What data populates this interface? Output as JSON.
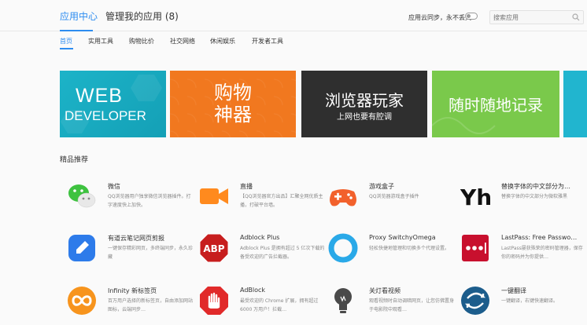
{
  "header": {
    "tab_app_center": "应用中心",
    "tab_manage": "管理我的应用 (8)",
    "sync_label": "应用云同步，永不丢失",
    "search_placeholder": "搜索应用"
  },
  "subnav": {
    "items": [
      "首页",
      "实用工具",
      "购物比价",
      "社交网络",
      "休闲娱乐",
      "开发者工具"
    ]
  },
  "banners": [
    {
      "line1": "WEB",
      "line2": "DEVELOPER",
      "color": "#17a9bf"
    },
    {
      "line1": "购物",
      "line2": "神器",
      "color": "#f1781f"
    },
    {
      "line1": "浏览器玩家",
      "line2": "上网也要有腔调",
      "color": "#2f2f2f"
    },
    {
      "line1": "随时随地记录",
      "color": "#7ac94b"
    },
    {
      "line1": "",
      "color": "#21b5cf"
    }
  ],
  "section": {
    "title": "精品推荐"
  },
  "apps": [
    {
      "name": "微信",
      "desc": "QQ浏览器用户独享微信浏览器插件。打字速度快上加快。",
      "icon": "wechat-icon"
    },
    {
      "name": "直播",
      "desc": "【QQ浏览器官方出品】汇聚全网优质主播，打破平台墙。",
      "icon": "live-camera-icon"
    },
    {
      "name": "游戏盒子",
      "desc": "QQ浏览器游戏盒子插件",
      "icon": "gamepad-icon"
    },
    {
      "name": "替换字体的中文部分为…",
      "desc": "替换字体的中文部分为微软雅黑",
      "icon": "yh-font-icon"
    },
    {
      "name": "有道云笔记网页剪报",
      "desc": "一键保存精彩网页，多终端同步，永久珍藏",
      "icon": "youdao-note-icon"
    },
    {
      "name": "Adblock Plus",
      "desc": "Adblock Plus 是拥有超过 5 亿次下载的备受欢迎的广告拦截器。",
      "icon": "abp-icon"
    },
    {
      "name": "Proxy SwitchyOmega",
      "desc": "轻松快捷地管理和切换多个代理设置。",
      "icon": "proxy-ring-icon"
    },
    {
      "name": "LastPass: Free Passwo…",
      "desc": "LastPass屡获殊荣的密码管理器，保存你的密码并为你提供…",
      "icon": "lastpass-icon"
    },
    {
      "name": "Infinity 新标签页",
      "desc": "百万用户选择的新标签页，自由添加网站图标，云端同步…",
      "icon": "infinity-icon"
    },
    {
      "name": "AdBlock",
      "desc": "最受欢迎的 Chrome 扩展，拥有超过 6000 万用户！拦截…",
      "icon": "adblock-hand-icon"
    },
    {
      "name": "关灯看视频",
      "desc": "观看视频时自动调暗网页，让您仿佛置身于电影院中观看…",
      "icon": "lightbulb-icon"
    },
    {
      "name": "一键翻译",
      "desc": "一键翻译，右键快速翻译。",
      "icon": "translate-icon"
    }
  ]
}
